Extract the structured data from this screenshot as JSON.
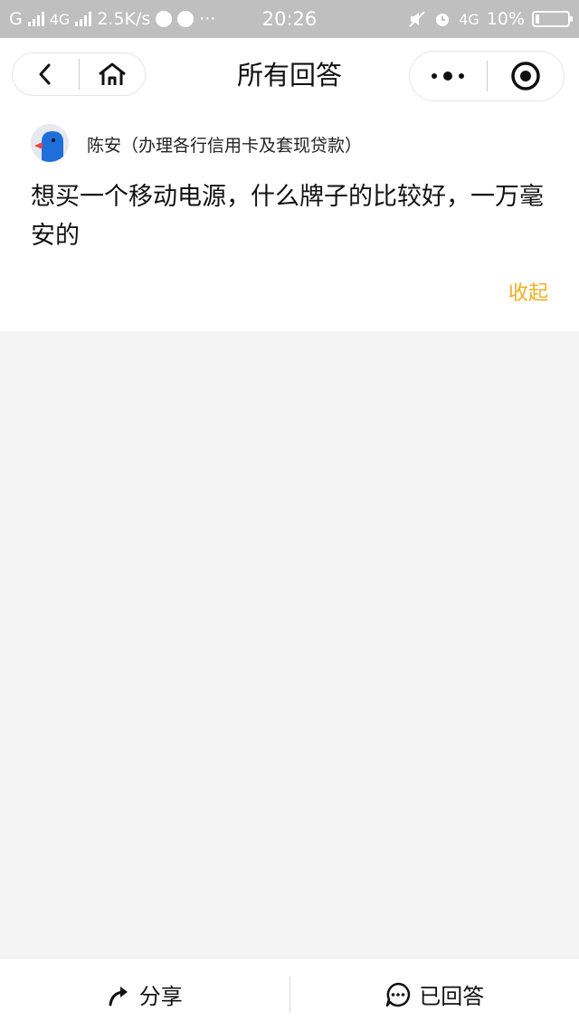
{
  "status_bar": {
    "network1": "G",
    "network2": "4G",
    "speed": "2.5K/s",
    "dots": "···",
    "time": "20:26",
    "network3": "4G",
    "battery": "10%"
  },
  "nav": {
    "title": "所有回答",
    "back_icon": "back-arrow-icon",
    "home_icon": "home-icon",
    "more_icon": "more-dots-icon",
    "close_icon": "close-target-icon"
  },
  "question": {
    "user": "陈安（办理各行信用卡及套现贷款）",
    "text": "想买一个移动电源，什么牌子的比较好，一万毫安的",
    "collapse_label": "收起"
  },
  "bottom": {
    "share_label": "分享",
    "answered_label": "已回答"
  },
  "colors": {
    "accent": "#f0b020",
    "background": "#f4f4f4",
    "status_bar": "#bfbfbf"
  }
}
